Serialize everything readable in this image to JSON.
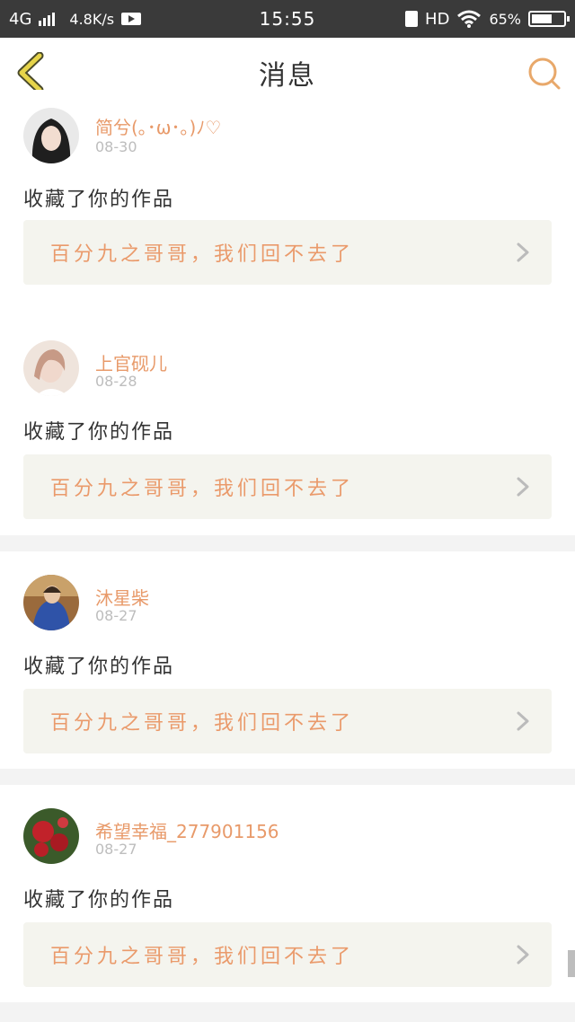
{
  "status_bar": {
    "network": "4G",
    "speed": "4.8K/s",
    "time": "15:55",
    "hd": "HD",
    "battery": "65%",
    "battery_level": 0.65
  },
  "nav": {
    "title": "消息",
    "back_icon": "chevron-left-icon",
    "search_icon": "search-icon",
    "accent_color": "#e8a86a"
  },
  "messages": [
    {
      "username": "简兮(｡･ω･｡)ﾉ♡",
      "date": "08-30",
      "action": "收藏了你的作品",
      "work_title": "百分九之哥哥，我们回不去了",
      "avatar_color": "#2b2b2b"
    },
    {
      "username": "上官砚儿",
      "date": "08-28",
      "action": "收藏了你的作品",
      "work_title": "百分九之哥哥，我们回不去了",
      "avatar_color": "#d8b8a6"
    },
    {
      "username": "沐星柴",
      "date": "08-27",
      "action": "收藏了你的作品",
      "work_title": "百分九之哥哥，我们回不去了",
      "avatar_color": "#6a4a2c"
    },
    {
      "username": "希望幸福_277901156",
      "date": "08-27",
      "action": "收藏了你的作品",
      "work_title": "百分九之哥哥，我们回不去了",
      "avatar_color": "#8a1f24"
    }
  ]
}
